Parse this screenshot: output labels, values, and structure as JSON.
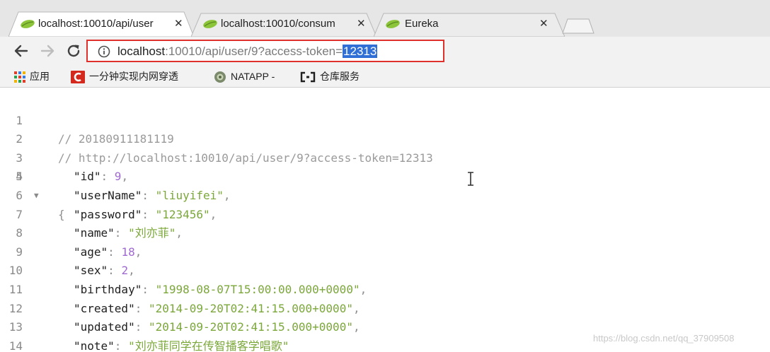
{
  "tabs": [
    {
      "title": "localhost:10010/api/user",
      "close": "✕"
    },
    {
      "title": "localhost:10010/consum",
      "close": "✕"
    },
    {
      "title": "Eureka",
      "close": "✕"
    }
  ],
  "address_bar": {
    "host": "localhost",
    "rest": ":10010/api/user/9?access-token=",
    "selected": "12313"
  },
  "bookmarks": [
    {
      "label": "应用",
      "icon": "apps-grid-icon"
    },
    {
      "label": "一分钟实现内网穿透",
      "icon": "red-c-logo-icon"
    },
    {
      "label": "NATAPP -",
      "icon": "natapp-logo-icon"
    },
    {
      "label": "仓库服务",
      "icon": "repo-logo-icon"
    }
  ],
  "json_view": {
    "line_numbers": [
      "1",
      "2",
      "3",
      "4",
      "5",
      "6",
      "7",
      "8",
      "9",
      "10",
      "11",
      "12",
      "13",
      "14"
    ],
    "comments": {
      "line1": "// 20180911181119",
      "line2": "// http://localhost:10010/api/user/9?access-token=12313"
    },
    "open_brace": "{",
    "fields": [
      {
        "key": "\"id\"",
        "value": "9",
        "kind": "num"
      },
      {
        "key": "\"userName\"",
        "value": "\"liuyifei\"",
        "kind": "str"
      },
      {
        "key": "\"password\"",
        "value": "\"123456\"",
        "kind": "str"
      },
      {
        "key": "\"name\"",
        "value": "\"刘亦菲\"",
        "kind": "str"
      },
      {
        "key": "\"age\"",
        "value": "18",
        "kind": "num"
      },
      {
        "key": "\"sex\"",
        "value": "2",
        "kind": "num"
      },
      {
        "key": "\"birthday\"",
        "value": "\"1998-08-07T15:00:00.000+0000\"",
        "kind": "str"
      },
      {
        "key": "\"created\"",
        "value": "\"2014-09-20T02:41:15.000+0000\"",
        "kind": "str"
      },
      {
        "key": "\"updated\"",
        "value": "\"2014-09-20T02:41:15.000+0000\"",
        "kind": "str"
      },
      {
        "key": "\"note\"",
        "value": "\"刘亦菲同学在传智播客学唱歌\"",
        "kind": "str"
      }
    ]
  },
  "watermark": "https://blog.csdn.net/qq_37909508",
  "colors": {
    "highlight_border": "#e0302c",
    "selection": "#2f6fd6",
    "string": "#7ba73a",
    "number": "#a06ad0",
    "comment": "#9a9a9a"
  }
}
